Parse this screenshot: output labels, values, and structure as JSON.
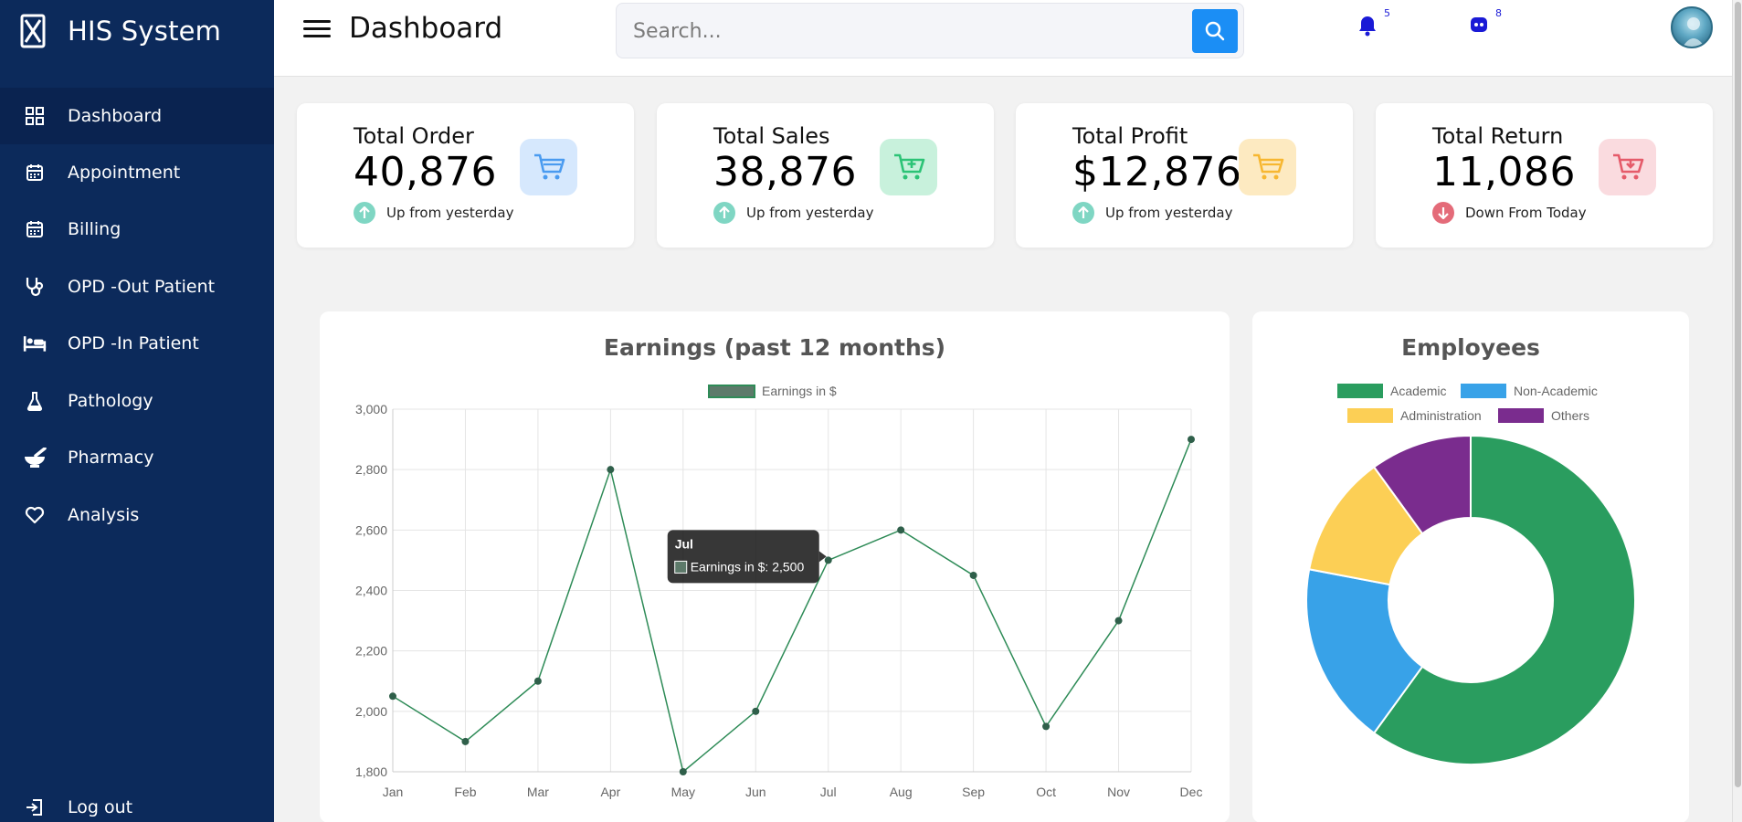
{
  "app": {
    "title": "HIS System"
  },
  "sidebar": {
    "items": [
      {
        "label": "Dashboard",
        "icon": "grid-icon",
        "active": true
      },
      {
        "label": "Appointment",
        "icon": "calendar-icon"
      },
      {
        "label": "Billing",
        "icon": "calendar-icon"
      },
      {
        "label": "OPD -Out Patient",
        "icon": "stethoscope-icon"
      },
      {
        "label": "OPD -In Patient",
        "icon": "bed-icon"
      },
      {
        "label": "Pathology",
        "icon": "flask-icon"
      },
      {
        "label": "Pharmacy",
        "icon": "mortar-pestle-icon"
      },
      {
        "label": "Analysis",
        "icon": "heart-icon"
      }
    ],
    "logout": "Log out"
  },
  "header": {
    "title": "Dashboard",
    "search_placeholder": "Search...",
    "notifications_count": "5",
    "messages_count": "8"
  },
  "cards": [
    {
      "label": "Total Order",
      "value": "40,876",
      "trend": "Up from yesterday",
      "direction": "up",
      "accent": "#4a9bf0",
      "bg": "#d6e8fd"
    },
    {
      "label": "Total Sales",
      "value": "38,876",
      "trend": "Up from yesterday",
      "direction": "up",
      "accent": "#2cc376",
      "bg": "#c8f1dc"
    },
    {
      "label": "Total Profit",
      "value": "$12,876",
      "trend": "Up from yesterday",
      "direction": "up",
      "accent": "#f7b731",
      "bg": "#fdeac1"
    },
    {
      "label": "Total Return",
      "value": "11,086",
      "trend": "Down From Today",
      "direction": "down",
      "accent": "#e55b6a",
      "bg": "#fadbdf"
    }
  ],
  "colors": {
    "sidebar": "#0c2a5b",
    "up": "#7fd6c3",
    "down": "#e46b79",
    "line": "#2e8b57",
    "point": "#2f5f4a"
  },
  "chart_data": [
    {
      "type": "line",
      "title": "Earnings (past 12 months)",
      "series": [
        {
          "name": "Earnings in $",
          "values": [
            2050,
            1900,
            2100,
            2800,
            1800,
            2000,
            2500,
            2600,
            2450,
            1950,
            2300,
            2900
          ]
        }
      ],
      "categories": [
        "Jan",
        "Feb",
        "Mar",
        "Apr",
        "May",
        "Jun",
        "Jul",
        "Aug",
        "Sep",
        "Oct",
        "Nov",
        "Dec"
      ],
      "ylim": [
        1800,
        3000
      ],
      "yticks": [
        "3,000",
        "2,800",
        "2,600",
        "2,400",
        "2,200",
        "2,000",
        "1,800"
      ],
      "grid": true,
      "legend": "top",
      "tooltip": {
        "title": "Jul",
        "text": "Earnings in $: 2,500"
      }
    },
    {
      "type": "pie",
      "title": "Employees",
      "labels": [
        "Academic",
        "Non-Academic",
        "Administration",
        "Others"
      ],
      "values": [
        60,
        18,
        12,
        10
      ],
      "colors": [
        "#2a9d5f",
        "#38a2e8",
        "#fccf55",
        "#7a2c8e"
      ],
      "legend": "top"
    }
  ]
}
